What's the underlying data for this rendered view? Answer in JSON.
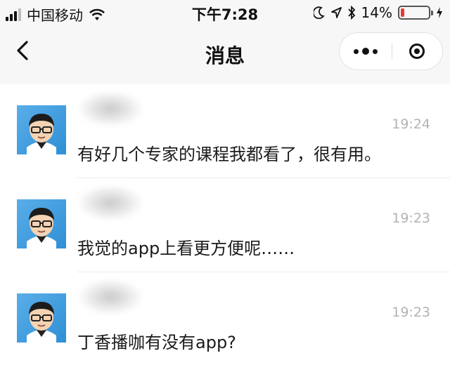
{
  "status_bar": {
    "carrier": "中国移动",
    "time": "下午7:28",
    "battery_percent": "14%",
    "battery_level": 0.14,
    "signal_bars": 4,
    "signal_bars_filled": 3,
    "icons": [
      "signal-icon",
      "wifi-icon",
      "moon-icon",
      "location-icon",
      "bluetooth-icon",
      "battery-icon",
      "charging-icon"
    ],
    "colors": {
      "battery_low": "#e53935"
    }
  },
  "nav": {
    "title": "消息",
    "icons": {
      "back": "back-chevron-icon",
      "more": "more-dots-icon",
      "close": "close-target-icon"
    }
  },
  "messages": [
    {
      "time": "19:24",
      "text": "有好几个专家的课程我都看了，很有用。"
    },
    {
      "time": "19:23",
      "text": "我觉的app上看更方便呢……"
    },
    {
      "time": "19:23",
      "text": "丁香播咖有没有app?"
    }
  ]
}
